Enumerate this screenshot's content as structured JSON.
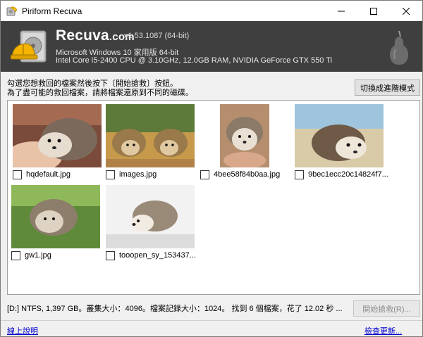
{
  "window": {
    "title": "Piriform Recuva",
    "icon": "recuva-app-icon",
    "controls": [
      "minimize-icon",
      "maximize-icon",
      "close-icon"
    ]
  },
  "header": {
    "brand": "Recuva",
    "brand_suffix": ".com",
    "version": "v1.53.1087 (64-bit)",
    "os_line": "Microsoft Windows 10 家用版 64-bit",
    "hw_line": "Intel Core i5-2400 CPU @ 3.10GHz, 12.0GB RAM, NVIDIA GeForce GTX 550 Ti",
    "background": "#3f3f3f"
  },
  "instructions": {
    "line1": "勾選您想救回的檔案然後按下〔開始搶救〕按鈕。",
    "line2": "為了盡可能的救回檔案，請將檔案還原到不同的磁碟。"
  },
  "advanced_button": "切換成進階模式",
  "files": [
    {
      "name": "hqdefault.jpg",
      "checked": false
    },
    {
      "name": "images.jpg",
      "checked": false
    },
    {
      "name": "4bee58f84b0aa.jpg",
      "checked": false
    },
    {
      "name": "9bec1ecc20c14824f7...",
      "checked": false
    },
    {
      "name": "gw1.jpg",
      "checked": false
    },
    {
      "name": "tooopen_sy_153437...",
      "checked": false
    }
  ],
  "status": "[D:] NTFS, 1,397 GB。叢集大小：4096。檔案記錄大小：1024。 找到 6 個檔案，花了 12.02 秒 ...",
  "recover_button": "開始搶救(R)...",
  "footer": {
    "help_link": "線上說明",
    "update_link": "檢查更新..."
  },
  "colors": {
    "accent_link": "#0000cc",
    "header_bg": "#3f3f3f"
  }
}
